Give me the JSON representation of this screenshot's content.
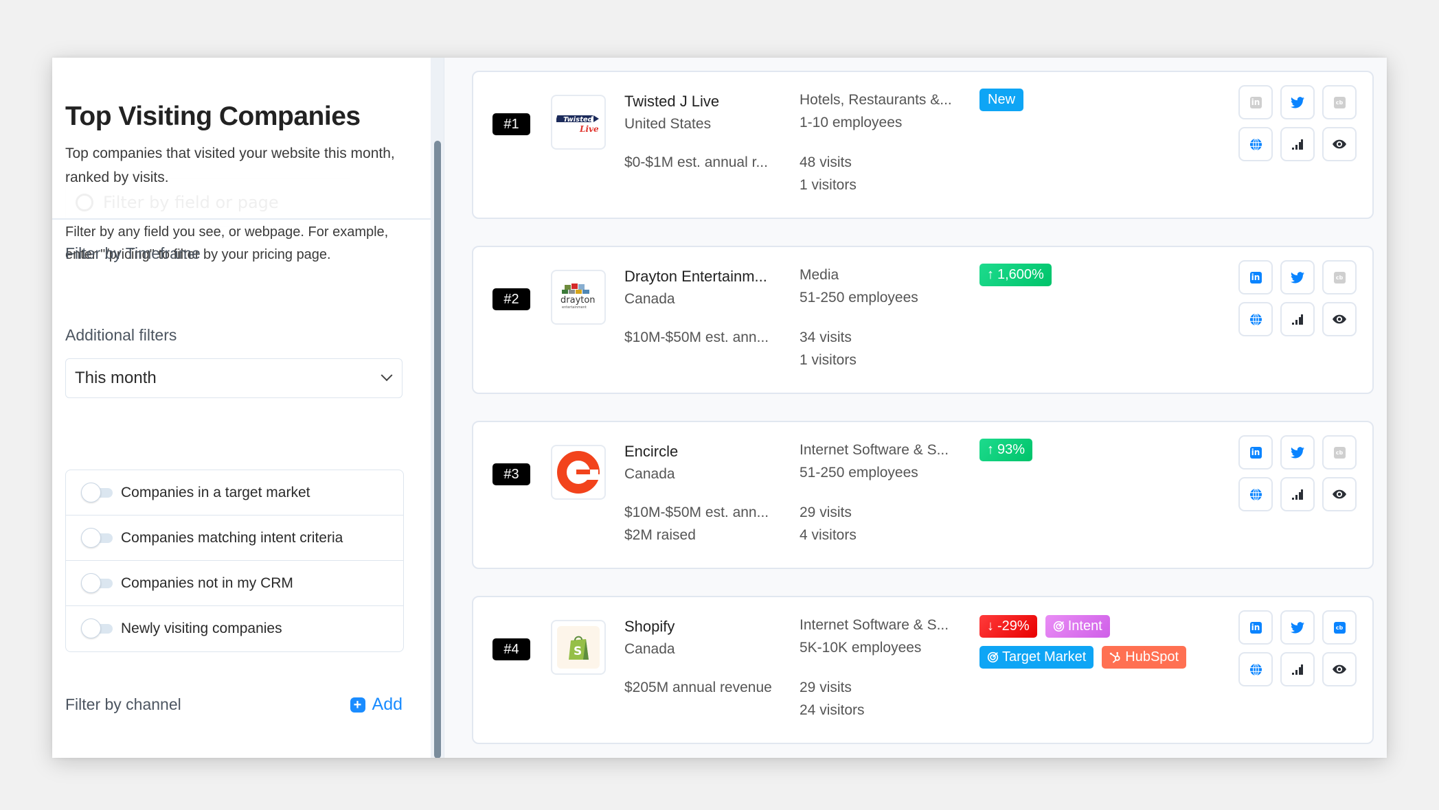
{
  "sidebar": {
    "title": "Top Visiting Companies",
    "subtitle": "Top companies that visited your website this month, ranked by visits.",
    "ghost_filter_placeholder": "Filter by field or page",
    "help_text": "Filter by any field you see, or webpage. For example, enter \"/pricing\" to filter by your pricing page.",
    "timeframe": {
      "label": "Filter by Timeframe",
      "selected": "This month"
    },
    "additional_filters": {
      "label": "Additional filters",
      "items": [
        {
          "label": "Companies in a target market",
          "enabled": false
        },
        {
          "label": "Companies matching intent criteria",
          "enabled": false
        },
        {
          "label": "Companies not in my CRM",
          "enabled": false
        },
        {
          "label": "Newly visiting companies",
          "enabled": false
        }
      ]
    },
    "channel": {
      "label": "Filter by channel",
      "add_label": "Add"
    }
  },
  "colors": {
    "accent_blue": "#1a8cff",
    "new_badge": "#0ea5f5",
    "up_badge": "#00c36a",
    "down_badge": "#e80000",
    "intent_badge": "#cf5fe8",
    "hubspot_badge": "#ff7052",
    "rank_badge": "#000000"
  },
  "companies": [
    {
      "rank": "#1",
      "logo": "twisted-j-live-logo",
      "name": "Twisted J Live",
      "location": "United States",
      "revenue": "$0-$1M est. annual r...",
      "funding": "",
      "industry": "Hotels, Restaurants &...",
      "employees": "1-10 employees",
      "visits": "48 visits",
      "visitors": "1 visitors",
      "tags": [
        {
          "type": "new",
          "label": "New",
          "icon": ""
        }
      ],
      "links": {
        "linkedin": false,
        "twitter": true,
        "crunchbase": false,
        "website": true,
        "analytics": true,
        "view": true
      }
    },
    {
      "rank": "#2",
      "logo": "drayton-entertainment-logo",
      "name": "Drayton Entertainm...",
      "location": "Canada",
      "revenue": "$10M-$50M est. ann...",
      "funding": "",
      "industry": "Media",
      "employees": "51-250 employees",
      "visits": "34 visits",
      "visitors": "1 visitors",
      "tags": [
        {
          "type": "up",
          "label": "1,600%",
          "icon": "↑"
        }
      ],
      "links": {
        "linkedin": true,
        "twitter": true,
        "crunchbase": false,
        "website": true,
        "analytics": true,
        "view": true
      }
    },
    {
      "rank": "#3",
      "logo": "encircle-logo",
      "name": "Encircle",
      "location": "Canada",
      "revenue": "$10M-$50M est. ann...",
      "funding": "$2M raised",
      "industry": "Internet Software & S...",
      "employees": "51-250 employees",
      "visits": "29 visits",
      "visitors": "4 visitors",
      "tags": [
        {
          "type": "up",
          "label": "93%",
          "icon": "↑"
        }
      ],
      "links": {
        "linkedin": true,
        "twitter": true,
        "crunchbase": false,
        "website": true,
        "analytics": true,
        "view": true
      }
    },
    {
      "rank": "#4",
      "logo": "shopify-logo",
      "name": "Shopify",
      "location": "Canada",
      "revenue": "$205M annual revenue",
      "funding": "",
      "industry": "Internet Software & S...",
      "employees": "5K-10K employees",
      "visits": "29 visits",
      "visitors": "24 visitors",
      "tags": [
        {
          "type": "down",
          "label": "-29%",
          "icon": "↓"
        },
        {
          "type": "intent",
          "label": "Intent",
          "icon": "target"
        },
        {
          "type": "target",
          "label": "Target Market",
          "icon": "target"
        },
        {
          "type": "hubspot",
          "label": "HubSpot",
          "icon": "hubspot"
        }
      ],
      "links": {
        "linkedin": true,
        "twitter": true,
        "crunchbase": true,
        "website": true,
        "analytics": true,
        "view": true
      }
    }
  ],
  "icons": {
    "linkedin_label": "in",
    "crunchbase_label": "cb"
  }
}
